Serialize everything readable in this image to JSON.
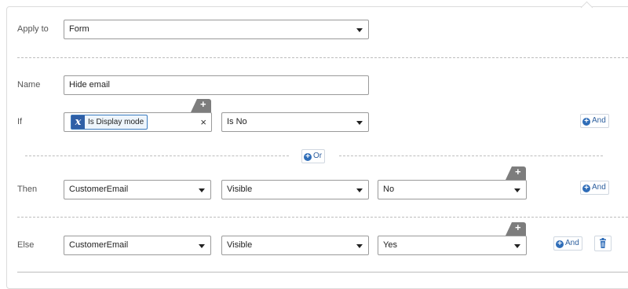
{
  "apply_to": {
    "label": "Apply to",
    "value": "Form"
  },
  "name": {
    "label": "Name",
    "value": "Hide email"
  },
  "if_row": {
    "label": "If",
    "chip_icon": "x",
    "chip_text": "Is Display mode",
    "clear_symbol": "×",
    "operator": "Is No",
    "and_label": "And"
  },
  "or_label": "Or",
  "then_row": {
    "label": "Then",
    "field": "CustomerEmail",
    "property": "Visible",
    "value": "No",
    "and_label": "And"
  },
  "else_row": {
    "label": "Else",
    "field": "CustomerEmail",
    "property": "Visible",
    "value": "Yes",
    "and_label": "And"
  },
  "icons": {
    "plus": "+",
    "and_plus": "+",
    "delete": "trash-icon",
    "clear": "close-icon",
    "variable": "variable-x-icon"
  },
  "colors": {
    "accent": "#2f6db8",
    "chip_bg": "#eef5fc",
    "chip_border": "#3b7bbf",
    "tab": "#7d7d7d"
  }
}
